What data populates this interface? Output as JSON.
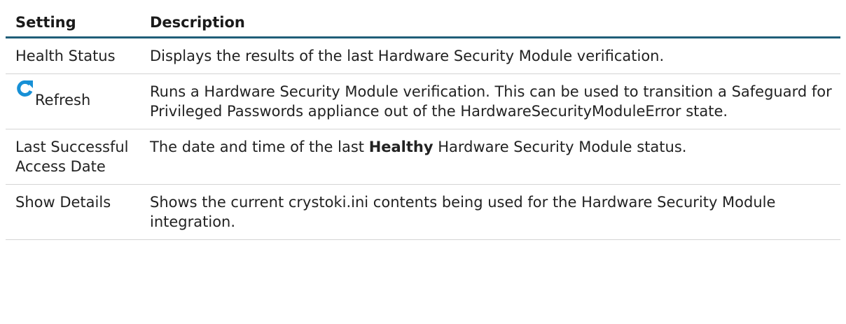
{
  "table": {
    "headers": {
      "setting": "Setting",
      "description": "Description"
    },
    "rows": [
      {
        "setting": "Health Status",
        "description": "Displays the results of the last Hardware Security Module verification."
      },
      {
        "setting": "Refresh",
        "setting_icon": "refresh-icon",
        "description": "Runs a Hardware Security Module verification. This can be used to transition a Safeguard for Privileged Passwords appliance out of the HardwareSecurityModuleError state."
      },
      {
        "setting": "Last Successful Access Date",
        "description_before": "The date and time of the last ",
        "description_bold": "Healthy",
        "description_after": " Hardware Security Module status."
      },
      {
        "setting": "Show Details",
        "description": "Shows the current crystoki.ini contents being used for the Hardware Security Module integration."
      }
    ]
  },
  "colors": {
    "header_rule": "#1f5e78",
    "row_rule": "#d4d4d4",
    "refresh_icon": "#1790d6"
  }
}
